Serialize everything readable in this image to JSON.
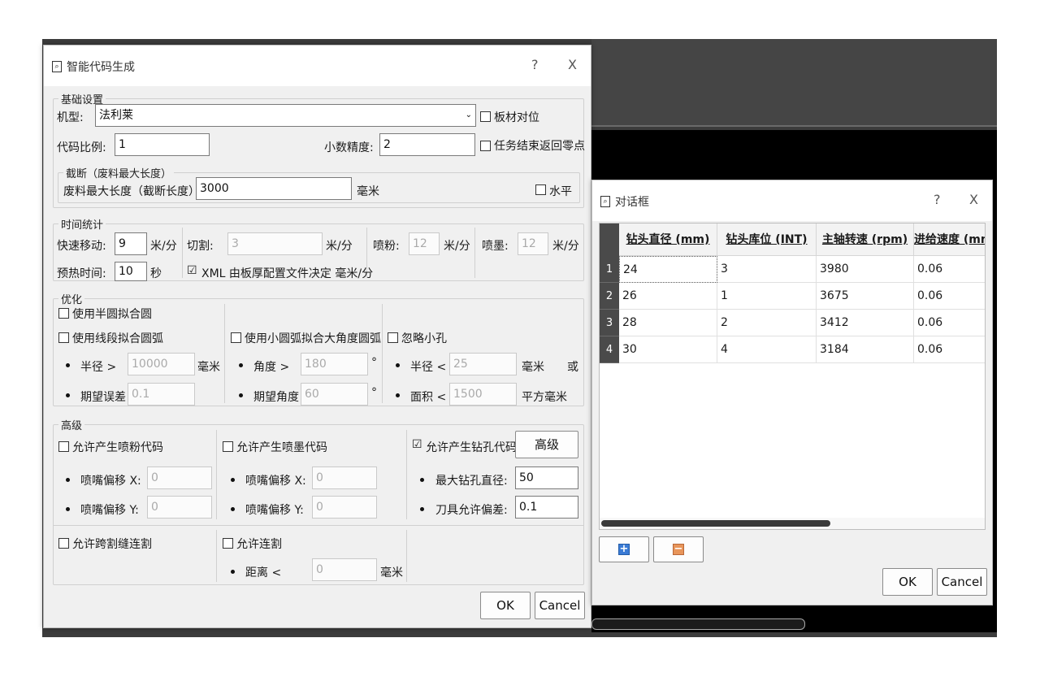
{
  "main_dialog": {
    "title": "智能代码生成",
    "help": "?",
    "close": "X",
    "basic": {
      "legend": "基础设置",
      "model_label": "机型:",
      "model_value": "法利莱",
      "board_align": "板材对位",
      "ratio_label": "代码比例:",
      "ratio_value": "1",
      "decimal_label": "小数精度:",
      "decimal_value": "2",
      "return_zero": "任务结束返回零点",
      "cut": {
        "legend": "截断（废料最大长度）",
        "max_label": "废料最大长度（截断长度）:",
        "max_value": "3000",
        "unit": "毫米",
        "horizontal": "水平"
      }
    },
    "time": {
      "legend": "时间统计",
      "fast_label": "快速移动:",
      "fast_value": "9",
      "fast_unit": "米/分",
      "cut_label": "切割:",
      "cut_value": "3",
      "cut_unit": "米/分",
      "powder_label": "喷粉:",
      "powder_value": "12",
      "powder_unit": "米/分",
      "ink_label": "喷墨:",
      "ink_value": "12",
      "ink_unit": "米/分",
      "preheat_label": "预热时间:",
      "preheat_value": "10",
      "preheat_unit": "秒",
      "xml_check": "☑",
      "xml_label": "XML 由板厚配置文件决定 毫米/分"
    },
    "optimize": {
      "legend": "优化",
      "semicircle": "使用半圆拟合圆",
      "segment_arc": "使用线段拟合圆弧",
      "radius_label": "半径 >",
      "radius_value": "10000",
      "radius_unit": "毫米",
      "error_label": "期望误差",
      "error_value": "0.1",
      "small_arc": "使用小圆弧拟合大角度圆弧",
      "angle_label": "角度 >",
      "angle_value": "180",
      "angle_unit": "°",
      "exp_angle_label": "期望角度",
      "exp_angle_value": "60",
      "exp_angle_unit": "°",
      "ignore_holes": "忽略小孔",
      "hole_radius_label": "半径 <",
      "hole_radius_value": "25",
      "hole_radius_unit": "毫米",
      "or_label": "或",
      "area_label": "面积 <",
      "area_value": "1500",
      "area_unit": "平方毫米"
    },
    "advanced": {
      "legend": "高级",
      "powder_code": "允许产生喷粉代码",
      "powder_x_label": "喷嘴偏移 X:",
      "powder_x_value": "0",
      "powder_y_label": "喷嘴偏移 Y:",
      "powder_y_value": "0",
      "ink_code": "允许产生喷墨代码",
      "ink_x_label": "喷嘴偏移 X:",
      "ink_x_value": "0",
      "ink_y_label": "喷嘴偏移 Y:",
      "ink_y_value": "0",
      "drill_check": "☑",
      "drill_code": "允许产生钻孔代码",
      "advanced_button": "高级",
      "max_drill_label": "最大钻孔直径:",
      "max_drill_value": "50",
      "tool_tol_label": "刀具允许偏差:",
      "tool_tol_value": "0.1",
      "cross_seam": "允许跨割缝连割",
      "chain_cut": "允许连割",
      "distance_label": "距离 <",
      "distance_value": "0",
      "distance_unit": "毫米"
    },
    "ok": "OK",
    "cancel": "Cancel"
  },
  "table_dialog": {
    "title": "对话框",
    "help": "?",
    "close": "X",
    "columns": [
      "钻头直径 (mm)",
      "钻头库位 (INT)",
      "主轴转速 (rpm)",
      "进给速度 (mm"
    ],
    "rows": [
      {
        "n": "1",
        "cells": [
          "24",
          "3",
          "3980",
          "0.06"
        ]
      },
      {
        "n": "2",
        "cells": [
          "26",
          "1",
          "3675",
          "0.06"
        ]
      },
      {
        "n": "3",
        "cells": [
          "28",
          "2",
          "3412",
          "0.06"
        ]
      },
      {
        "n": "4",
        "cells": [
          "30",
          "4",
          "3184",
          "0.06"
        ]
      }
    ],
    "add_icon": "+",
    "remove_icon": "−",
    "ok": "OK",
    "cancel": "Cancel"
  }
}
